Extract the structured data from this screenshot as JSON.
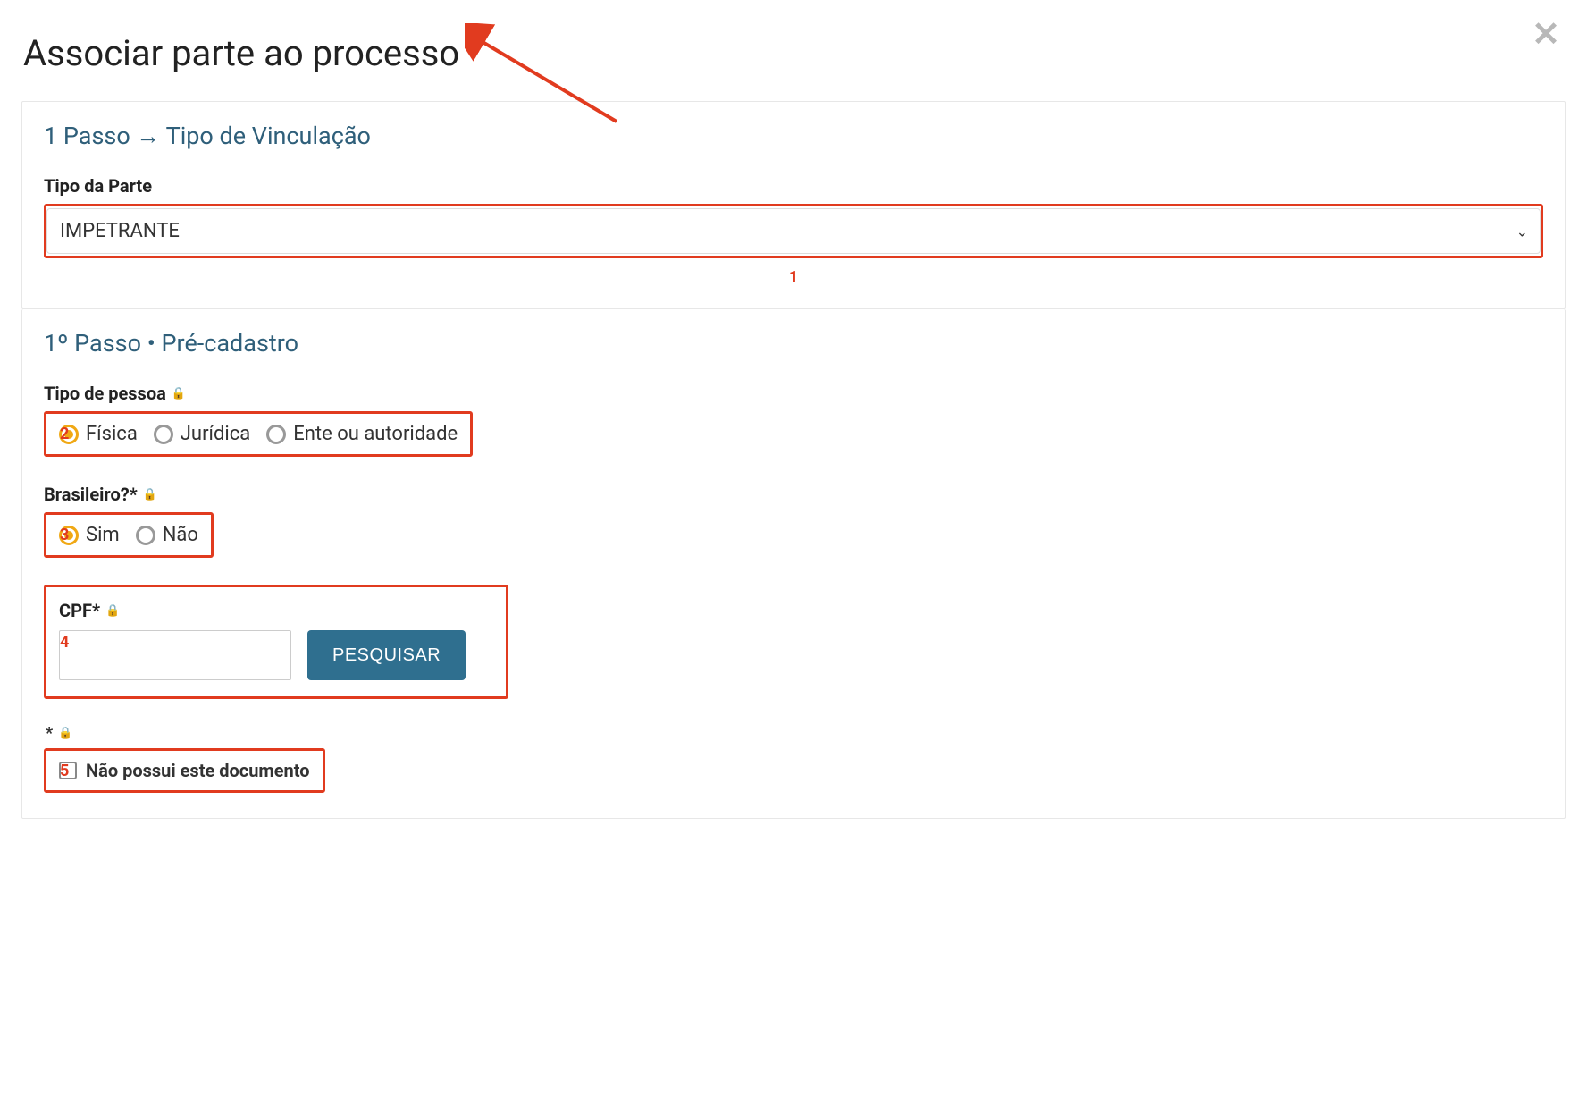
{
  "modal": {
    "title": "Associar parte ao processo",
    "close_glyph": "✕"
  },
  "step1": {
    "title": "1 Passo → Tipo de Vinculação",
    "tipo_parte_label": "Tipo da Parte",
    "tipo_parte_value": "IMPETRANTE",
    "annotation": "1"
  },
  "step2": {
    "title": "1º Passo • Pré-cadastro",
    "tipo_pessoa": {
      "label": "Tipo de pessoa",
      "options": {
        "fisica": "Física",
        "juridica": "Jurídica",
        "ente": "Ente ou autoridade"
      },
      "selected": "fisica",
      "annotation": "2"
    },
    "brasileiro": {
      "label": "Brasileiro?*",
      "options": {
        "sim": "Sim",
        "nao": "Não"
      },
      "selected": "sim",
      "annotation": "3"
    },
    "cpf": {
      "label": "CPF*",
      "value": "",
      "search_label": "PESQUISAR",
      "annotation": "4"
    },
    "no_doc": {
      "star": "*",
      "label": "Não possui este documento",
      "checked": false,
      "annotation": "5"
    }
  },
  "icons": {
    "lock": "🔒",
    "caret": "⌄"
  }
}
